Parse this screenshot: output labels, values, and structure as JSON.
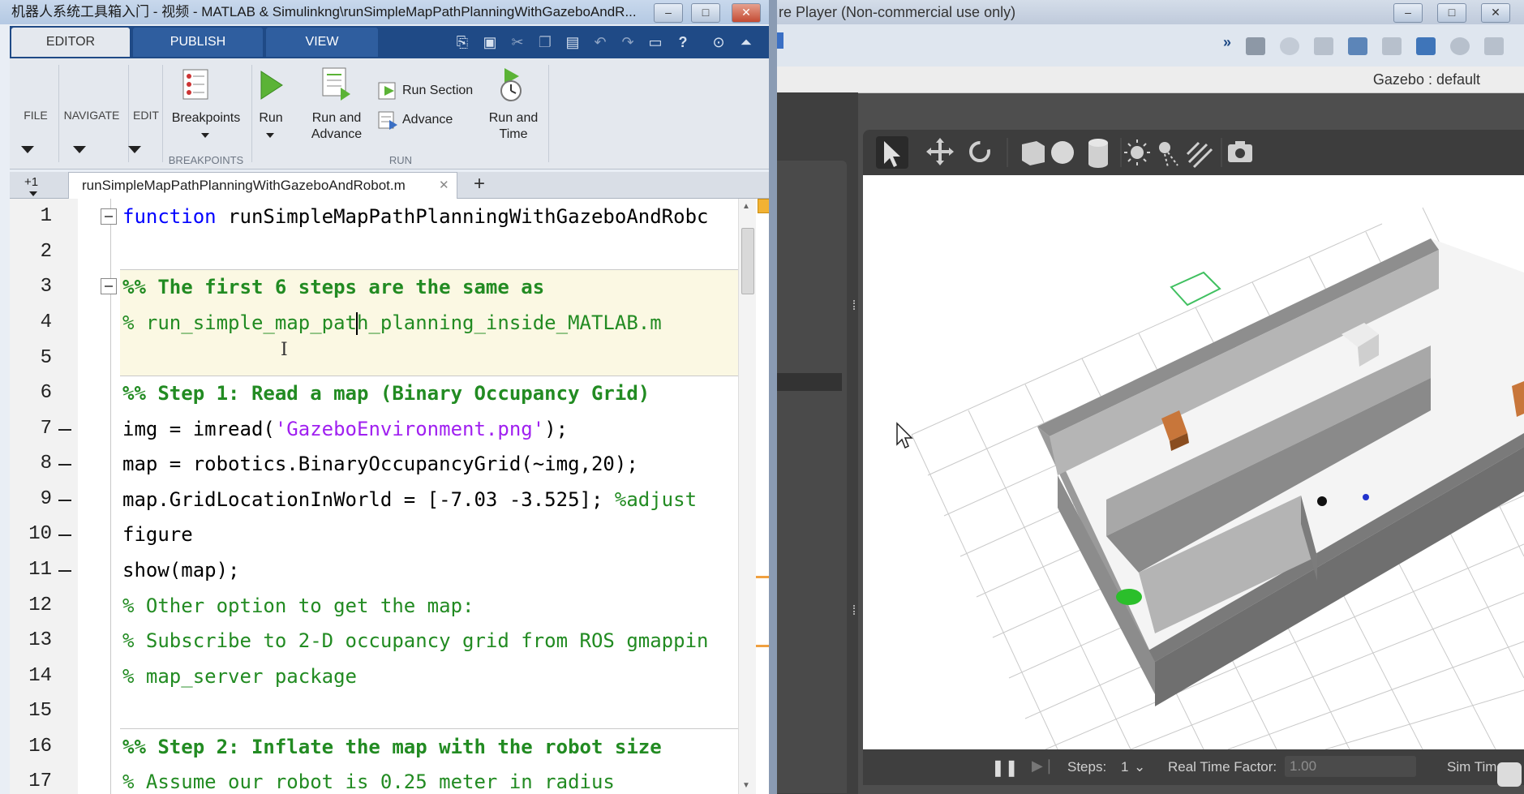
{
  "matlab": {
    "title": "机器人系统工具箱入门 - 视频 - MATLAB & Simulink",
    "title_path": "ng\\runSimpleMapPathPlanningWithGazeboAndR...",
    "window_controls": [
      "–",
      "□",
      "✕"
    ],
    "ribbon_tabs": [
      "EDITOR",
      "PUBLISH",
      "VIEW"
    ],
    "ribbon": {
      "file": "FILE",
      "navigate": "NAVIGATE",
      "edit": "EDIT",
      "breakpoints": "Breakpoints",
      "breakpoints_group": "BREAKPOINTS",
      "run": "Run",
      "run_and_advance_1": "Run and",
      "run_and_advance_2": "Advance",
      "run_section": "Run Section",
      "advance": "Advance",
      "run_and_time_1": "Run and",
      "run_and_time_2": "Time",
      "run_group": "RUN"
    },
    "file_tab": {
      "plus_one": "+1",
      "filename": "runSimpleMapPathPlanningWithGazeboAndRobot.m",
      "close": "✕",
      "add": "+"
    },
    "lines": [
      {
        "n": "1"
      },
      {
        "n": "2"
      },
      {
        "n": "3"
      },
      {
        "n": "4"
      },
      {
        "n": "5"
      },
      {
        "n": "6"
      },
      {
        "n": "7"
      },
      {
        "n": "8"
      },
      {
        "n": "9"
      },
      {
        "n": "10"
      },
      {
        "n": "11"
      },
      {
        "n": "12"
      },
      {
        "n": "13"
      },
      {
        "n": "14"
      },
      {
        "n": "15"
      },
      {
        "n": "16"
      },
      {
        "n": "17"
      }
    ],
    "code": {
      "l1_kw": "function",
      "l1_rest": " runSimpleMapPathPlanningWithGazeboAndRobc",
      "l3": "%% The first 6 steps are the same as",
      "l4": "% run_simple_map_path_planning_inside_MATLAB.m",
      "l6": "%% Step 1: Read a map (Binary Occupancy Grid)",
      "l7_a": "img = imread(",
      "l7_s": "'GazeboEnvironment.png'",
      "l7_b": ");",
      "l8": "map = robotics.BinaryOccupancyGrid(~img,20);",
      "l9_a": "map.GridLocationInWorld = [-7.03 -3.525]; ",
      "l9_c": "%adjust",
      "l10": "figure",
      "l11": "show(map);",
      "l12": "% Other option to get the map:",
      "l13": "% Subscribe to 2-D occupancy grid from ROS gmappin",
      "l14": "% map_server package",
      "l16": "%% Step 2: Inflate the map with the robot size",
      "l17": "% Assume our robot is 0.25 meter in radius"
    }
  },
  "gazebo": {
    "title": "re Player (Non-commercial use only)",
    "window_controls": [
      "–",
      "□",
      "✕"
    ],
    "menubar_text": "Gazebo : default",
    "bottom": {
      "pause": "❚❚",
      "step_icon": "▶❘",
      "steps_label": "Steps:",
      "steps_value": "1",
      "rtf_label": "Real Time Factor:",
      "rtf_value": "1.00",
      "sim_time_label": "Sim Time:"
    }
  }
}
